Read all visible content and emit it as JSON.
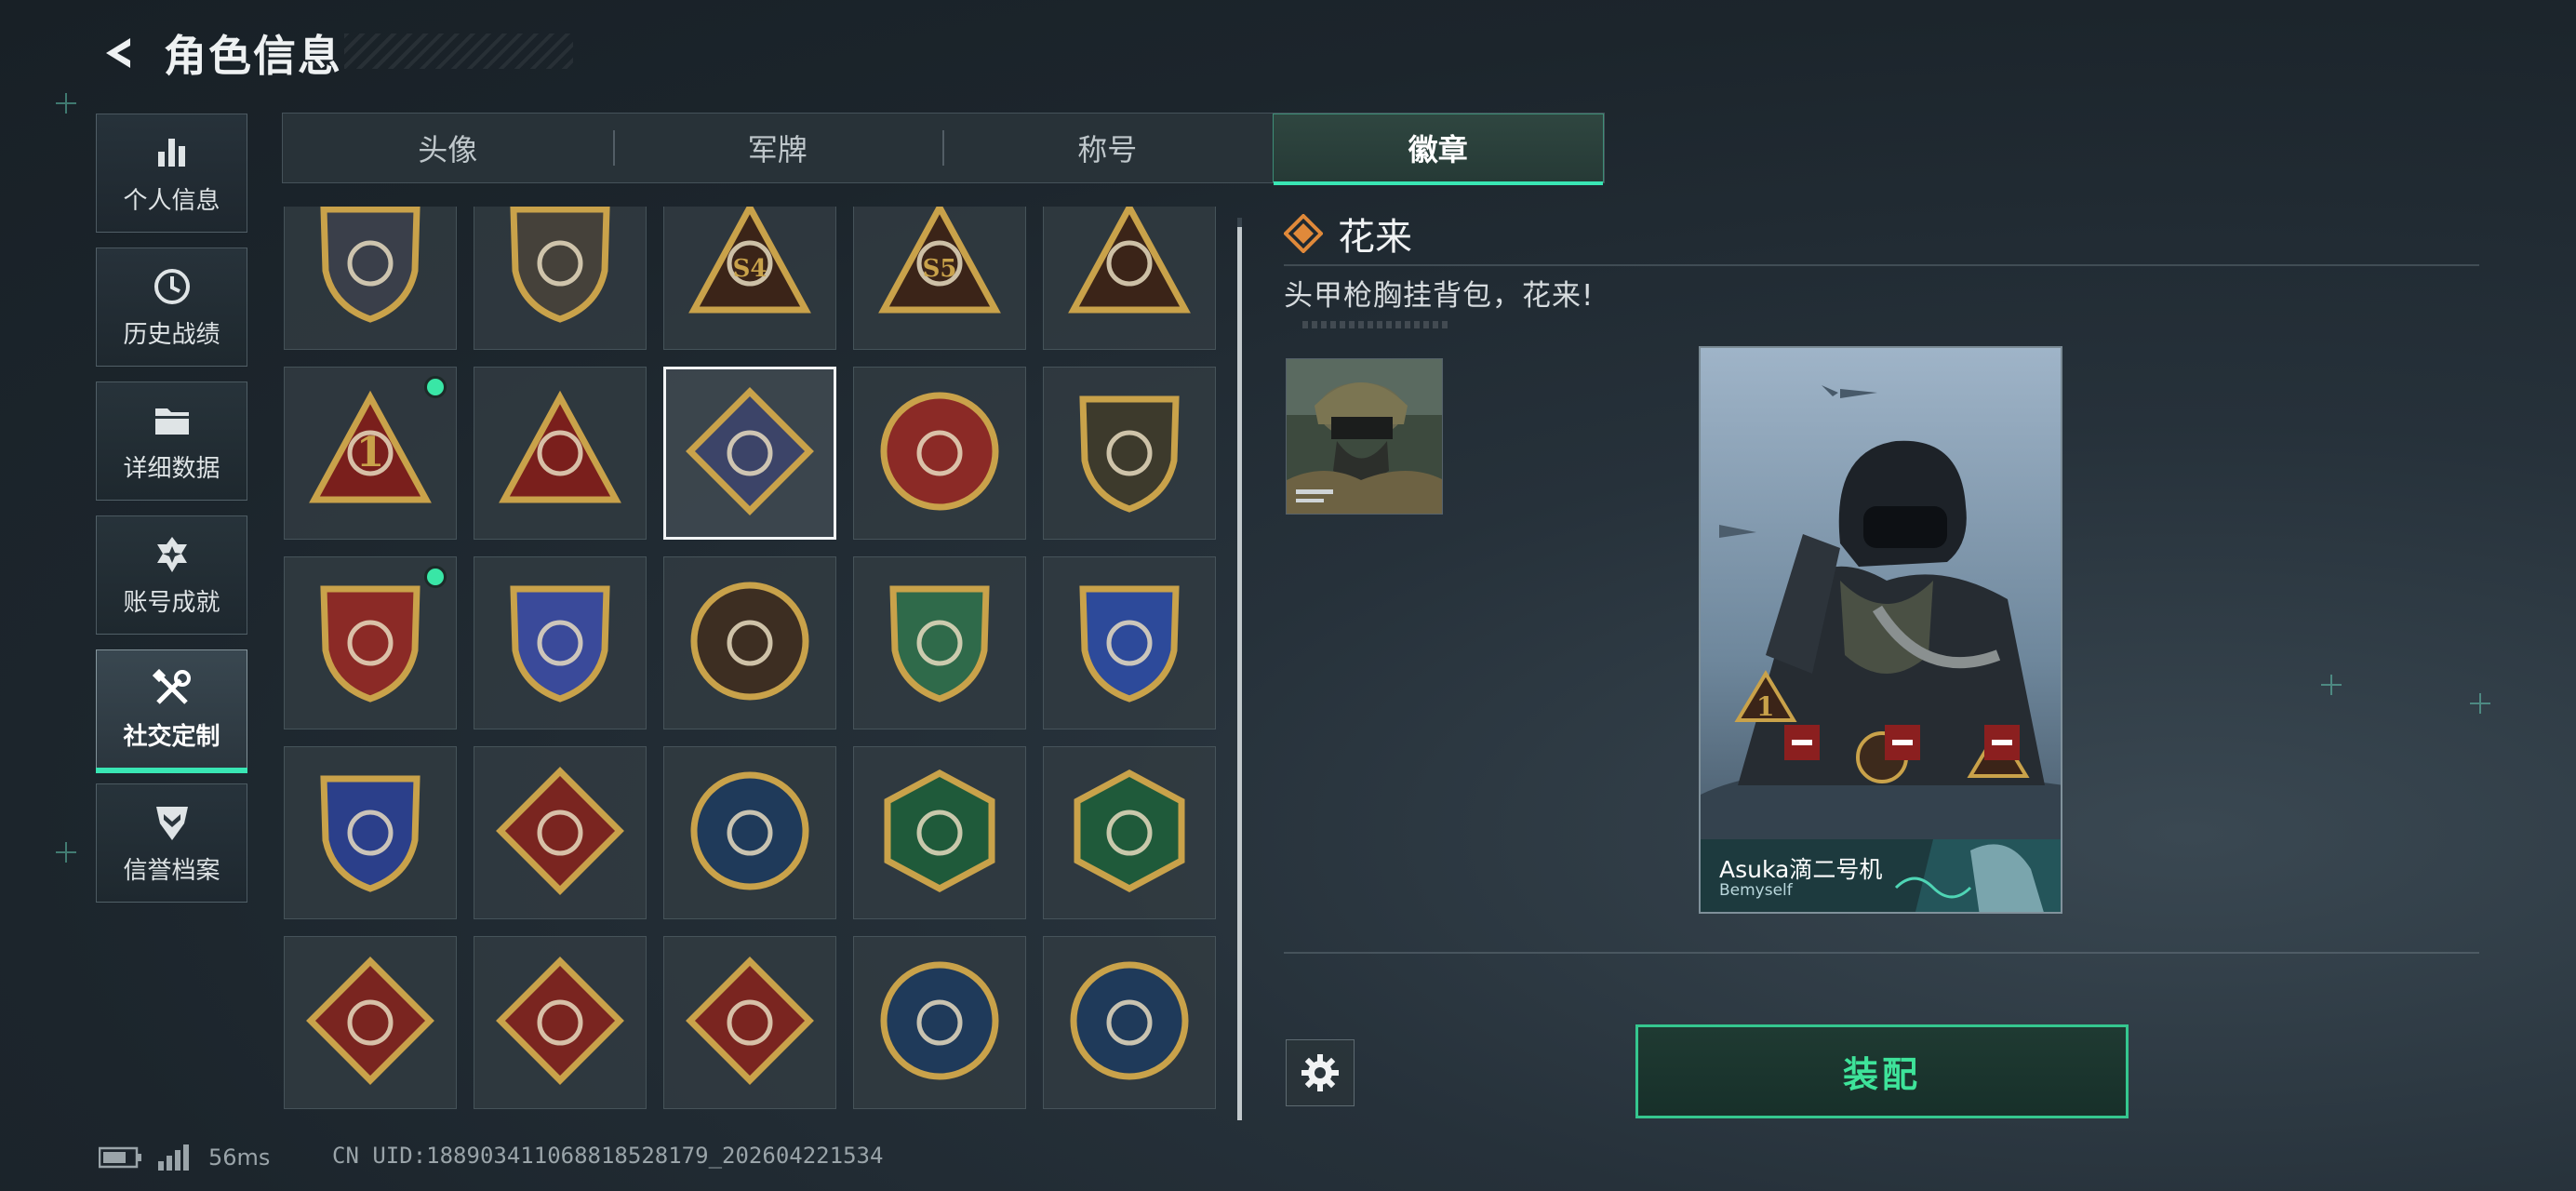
{
  "header": {
    "title": "角色信息"
  },
  "sidebar": {
    "items": [
      {
        "label": "个人信息",
        "icon": "bar-chart-icon"
      },
      {
        "label": "历史战绩",
        "icon": "history-clock-icon"
      },
      {
        "label": "详细数据",
        "icon": "folder-icon"
      },
      {
        "label": "账号成就",
        "icon": "achievement-star-icon"
      },
      {
        "label": "社交定制",
        "icon": "tools-icon",
        "active": true
      },
      {
        "label": "信誉档案",
        "icon": "shield-chevron-icon"
      }
    ]
  },
  "tabs": [
    {
      "label": "头像"
    },
    {
      "label": "军牌"
    },
    {
      "label": "称号"
    },
    {
      "label": "徽章",
      "active": true
    }
  ],
  "badges": {
    "selected_index": 7,
    "new_indicator_indices": [
      5,
      10
    ],
    "items": [
      {
        "icon": "triangle-emblem-badge"
      },
      {
        "icon": "helicopter-badge"
      },
      {
        "icon": "s4-trophy-badge",
        "text": "S4"
      },
      {
        "icon": "s5-trophy-badge",
        "text": "S5"
      },
      {
        "icon": "gold-nest-badge"
      },
      {
        "icon": "number-one-badge",
        "text": "1"
      },
      {
        "icon": "squad-soldiers-badge"
      },
      {
        "icon": "white-rose-badge"
      },
      {
        "icon": "star-compass-badge"
      },
      {
        "icon": "gold-shield-chevron-badge"
      },
      {
        "icon": "red-ribbon-shield-badge"
      },
      {
        "icon": "blue-crystal-shield-badge"
      },
      {
        "icon": "masked-agent-badge"
      },
      {
        "icon": "green-crosshair-rifle-badge"
      },
      {
        "icon": "blue-crosshair-rifle-badge"
      },
      {
        "icon": "gold-crosshair-shield-badge"
      },
      {
        "icon": "wolf-head-badge"
      },
      {
        "icon": "eagle-head-badge"
      },
      {
        "icon": "wasp-badge"
      },
      {
        "icon": "medic-hand-badge"
      },
      {
        "icon": "red-dragon-badge"
      },
      {
        "icon": "red-dragon-badge-alt"
      },
      {
        "icon": "runner-badge"
      },
      {
        "icon": "lynx-badge"
      },
      {
        "icon": "lynx-badge-alt"
      }
    ]
  },
  "detail": {
    "name": "花来",
    "description": "头甲枪胸挂背包，花来!",
    "card": {
      "player_name": "Asuka滴二号机",
      "subtitle": "Bemyself"
    },
    "equip_label": "装配"
  },
  "footer": {
    "ping": "56ms",
    "uid": "CN UID:18890341106881852817​9_202604221534"
  },
  "colors": {
    "accent": "#39e6b4",
    "equip_text": "#3ee39a",
    "badge_gold": "#c9a24a",
    "badge_red": "#8b2a26"
  }
}
